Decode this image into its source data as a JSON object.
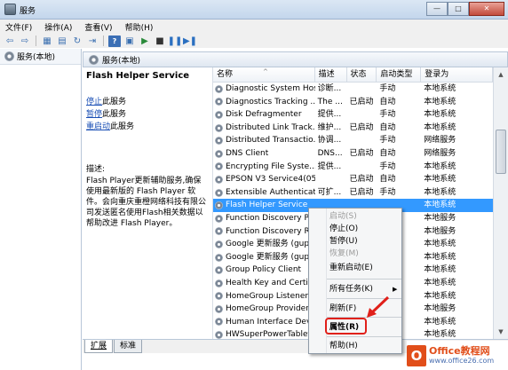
{
  "window": {
    "title": "服务",
    "minimize": "—",
    "maximize": "□",
    "close": "✕"
  },
  "menu": [
    "文件(F)",
    "操作(A)",
    "查看(V)",
    "帮助(H)"
  ],
  "toolbar_icons": [
    "back-arrow",
    "forward-arrow",
    "show-hide-tree",
    "properties",
    "refresh",
    "export",
    "help",
    "start",
    "stop",
    "pause",
    "restart"
  ],
  "toolbar_glyphs": {
    "back": "⇦",
    "forward": "⇨",
    "tree": "▦",
    "props": "▤",
    "refresh": "↻",
    "export": "⇥",
    "help": "?",
    "play": "▶",
    "stop": "■",
    "pause": "❚❚",
    "restart": "▶❚"
  },
  "leftpane": {
    "label": "服务(本地)"
  },
  "main": {
    "header": "服务(本地)"
  },
  "description": {
    "service_name": "Flash Helper Service",
    "link1": "停止",
    "link1_suffix": "此服务",
    "link2": "暂停",
    "link2_suffix": "此服务",
    "link3": "重启动",
    "link3_suffix": "此服务",
    "desc_label": "描述:",
    "desc_text": "Flash Player更新辅助服务,确保使用最新版的 Flash Player 软件。会向重庆重橙网络科技有限公司发送匿名使用Flash相关数据以帮助改进 Flash Player。"
  },
  "table": {
    "columns": [
      "名称",
      "描述",
      "状态",
      "启动类型",
      "登录为"
    ],
    "rows": [
      [
        "Diagnostic System Host",
        "诊断...",
        "",
        "手动",
        "本地系统"
      ],
      [
        "Diagnostics Tracking ...",
        "The ...",
        "已启动",
        "自动",
        "本地系统"
      ],
      [
        "Disk Defragmenter",
        "提供...",
        "",
        "手动",
        "本地系统"
      ],
      [
        "Distributed Link Track...",
        "维护...",
        "已启动",
        "自动",
        "本地系统"
      ],
      [
        "Distributed Transactio...",
        "协调...",
        "",
        "手动",
        "网络服务"
      ],
      [
        "DNS Client",
        "DNS...",
        "已启动",
        "自动",
        "网络服务"
      ],
      [
        "Encrypting File Syste...",
        "提供...",
        "",
        "手动",
        "本地系统"
      ],
      [
        "EPSON V3 Service4(05)",
        "",
        "已启动",
        "自动",
        "本地系统"
      ],
      [
        "Extensible Authenticat...",
        "可扩...",
        "已启动",
        "手动",
        "本地系统"
      ],
      [
        "Flash Helper Service",
        "",
        "",
        "",
        "本地系统"
      ],
      [
        "Function Discovery Pr...",
        "",
        "",
        "",
        "本地服务"
      ],
      [
        "Function Discovery Re...",
        "",
        "",
        "",
        "本地服务"
      ],
      [
        "Google 更新服务 (gup...",
        "",
        "",
        "",
        "本地系统"
      ],
      [
        "Google 更新服务 (gup...",
        "",
        "",
        "",
        "本地系统"
      ],
      [
        "Group Policy Client",
        "",
        "",
        "",
        "本地系统"
      ],
      [
        "Health Key and Certifi...",
        "",
        "",
        "",
        "本地系统"
      ],
      [
        "HomeGroup Listener",
        "",
        "",
        "",
        "本地系统"
      ],
      [
        "HomeGroup Provider",
        "",
        "",
        "",
        "本地服务"
      ],
      [
        "Human Interface Devi...",
        "",
        "",
        "",
        "本地系统"
      ],
      [
        "HWSuperPowerTablet",
        "",
        "",
        "",
        "本地系统"
      ]
    ],
    "selected_index": 9
  },
  "context_menu": {
    "items": [
      {
        "label": "启动(S)",
        "enabled": false
      },
      {
        "label": "停止(O)",
        "enabled": true
      },
      {
        "label": "暂停(U)",
        "enabled": true
      },
      {
        "label": "恢复(M)",
        "enabled": false
      },
      {
        "label": "重新启动(E)",
        "enabled": true
      },
      {
        "label": "所有任务(K)",
        "enabled": true,
        "submenu": true
      },
      {
        "label": "刷新(F)",
        "enabled": true
      },
      {
        "label": "属性(R)",
        "enabled": true,
        "bold": true
      },
      {
        "label": "帮助(H)",
        "enabled": true
      }
    ],
    "submenu_arrow": "▶"
  },
  "tabs": [
    "扩展",
    "标准"
  ],
  "watermark": {
    "logo": "O",
    "line1": "Office教程网",
    "line2": "www.office26.com"
  },
  "colors": {
    "selection": "#3399ff",
    "highlight_red": "#e0201a",
    "link": "#1a4fb5",
    "watermark": "#e14e1a"
  }
}
